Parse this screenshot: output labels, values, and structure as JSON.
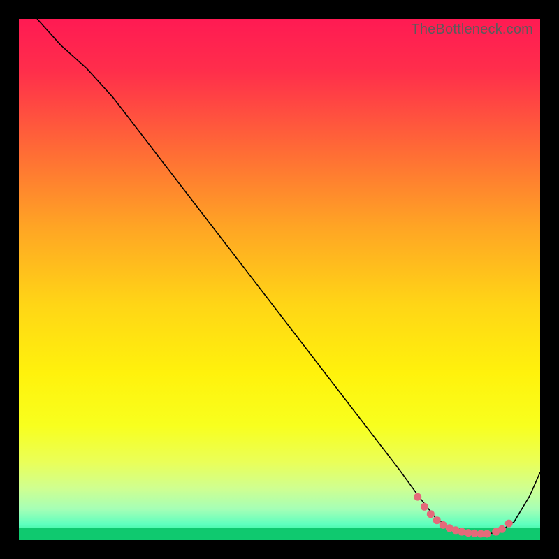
{
  "watermark": "TheBottleneck.com",
  "gradient_stops": [
    {
      "offset": 0.0,
      "color": "#ff1a53"
    },
    {
      "offset": 0.1,
      "color": "#ff2e4b"
    },
    {
      "offset": 0.25,
      "color": "#ff6a36"
    },
    {
      "offset": 0.4,
      "color": "#ffa524"
    },
    {
      "offset": 0.55,
      "color": "#ffd616"
    },
    {
      "offset": 0.68,
      "color": "#fff20c"
    },
    {
      "offset": 0.78,
      "color": "#f8ff1e"
    },
    {
      "offset": 0.85,
      "color": "#eaff58"
    },
    {
      "offset": 0.9,
      "color": "#d0ff90"
    },
    {
      "offset": 0.94,
      "color": "#a6ffb6"
    },
    {
      "offset": 0.97,
      "color": "#5effbe"
    },
    {
      "offset": 1.0,
      "color": "#16e07f"
    }
  ],
  "green_bar": {
    "y_from": 0.976,
    "color": "#0fc96f"
  },
  "chart_data": {
    "type": "line",
    "title": "",
    "xlabel": "",
    "ylabel": "",
    "xlim": [
      0,
      100
    ],
    "ylim": [
      0,
      100
    ],
    "series": [
      {
        "name": "curve",
        "stroke": "#000000",
        "stroke_width": 1.6,
        "x": [
          3.5,
          8,
          13,
          18,
          23,
          28,
          33,
          38,
          43,
          48,
          53,
          58,
          63,
          68,
          73,
          77,
          80,
          83,
          86,
          89,
          92,
          95,
          98,
          100
        ],
        "y": [
          100,
          95,
          90.5,
          85,
          78.5,
          72,
          65.5,
          59,
          52.5,
          46,
          39.5,
          33,
          26.5,
          20,
          13.5,
          8,
          4.2,
          2.2,
          1.3,
          1.1,
          1.5,
          3.5,
          8.5,
          13
        ]
      }
    ],
    "markers": {
      "name": "dotted-valley",
      "color": "#e46a7a",
      "radius": 5.5,
      "x": [
        76.5,
        77.8,
        79.0,
        80.2,
        81.4,
        82.6,
        83.8,
        85.0,
        86.2,
        87.4,
        88.6,
        89.8,
        91.5,
        92.7,
        94.0
      ],
      "y": [
        8.3,
        6.4,
        5.0,
        3.8,
        2.9,
        2.3,
        1.9,
        1.6,
        1.4,
        1.3,
        1.2,
        1.2,
        1.6,
        2.1,
        3.2
      ]
    }
  }
}
